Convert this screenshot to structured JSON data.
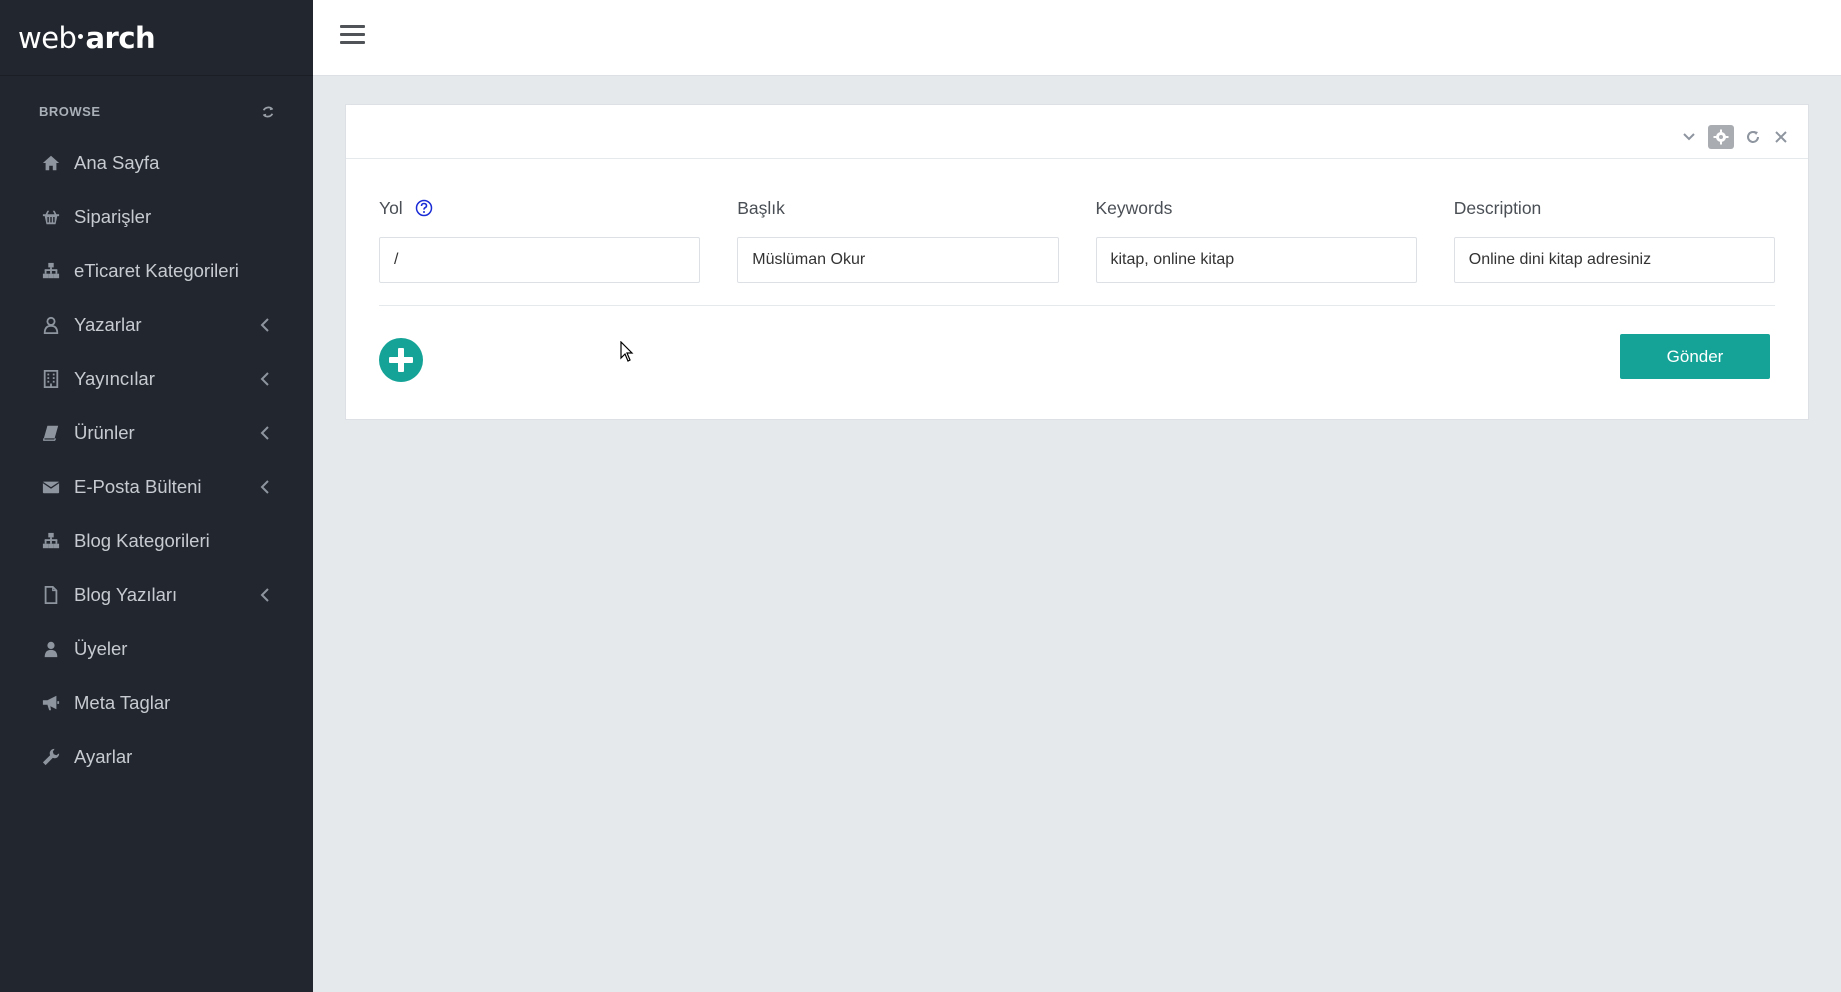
{
  "brand": {
    "logo_left": "web",
    "logo_right": "arch"
  },
  "sidebar": {
    "section_label": "BROWSE",
    "items": [
      {
        "label": "Ana Sayfa",
        "icon": "home-icon",
        "has_submenu": false
      },
      {
        "label": "Siparişler",
        "icon": "basket-icon",
        "has_submenu": false
      },
      {
        "label": "eTicaret Kategorileri",
        "icon": "sitemap-icon",
        "has_submenu": false
      },
      {
        "label": "Yazarlar",
        "icon": "user-outline-icon",
        "has_submenu": true
      },
      {
        "label": "Yayıncılar",
        "icon": "building-icon",
        "has_submenu": true
      },
      {
        "label": "Ürünler",
        "icon": "book-icon",
        "has_submenu": true
      },
      {
        "label": "E-Posta Bülteni",
        "icon": "envelope-icon",
        "has_submenu": true
      },
      {
        "label": "Blog Kategorileri",
        "icon": "sitemap-icon",
        "has_submenu": false
      },
      {
        "label": "Blog Yazıları",
        "icon": "file-icon",
        "has_submenu": true
      },
      {
        "label": "Üyeler",
        "icon": "user-icon",
        "has_submenu": false
      },
      {
        "label": "Meta Taglar",
        "icon": "bullhorn-icon",
        "has_submenu": false
      },
      {
        "label": "Ayarlar",
        "icon": "wrench-icon",
        "has_submenu": false
      }
    ]
  },
  "form": {
    "fields": [
      {
        "label": "Yol",
        "value": "/",
        "has_help": true
      },
      {
        "label": "Başlık",
        "value": "Müslüman Okur",
        "has_help": false
      },
      {
        "label": "Keywords",
        "value": "kitap, online kitap",
        "has_help": false
      },
      {
        "label": "Description",
        "value": "Online dini kitap adresiniz",
        "has_help": false
      }
    ],
    "submit_label": "Gönder"
  },
  "colors": {
    "sidebar_bg": "#22262e",
    "accent": "#15a397",
    "content_bg": "#e5e9ec",
    "help_icon": "#1a2cd6"
  }
}
